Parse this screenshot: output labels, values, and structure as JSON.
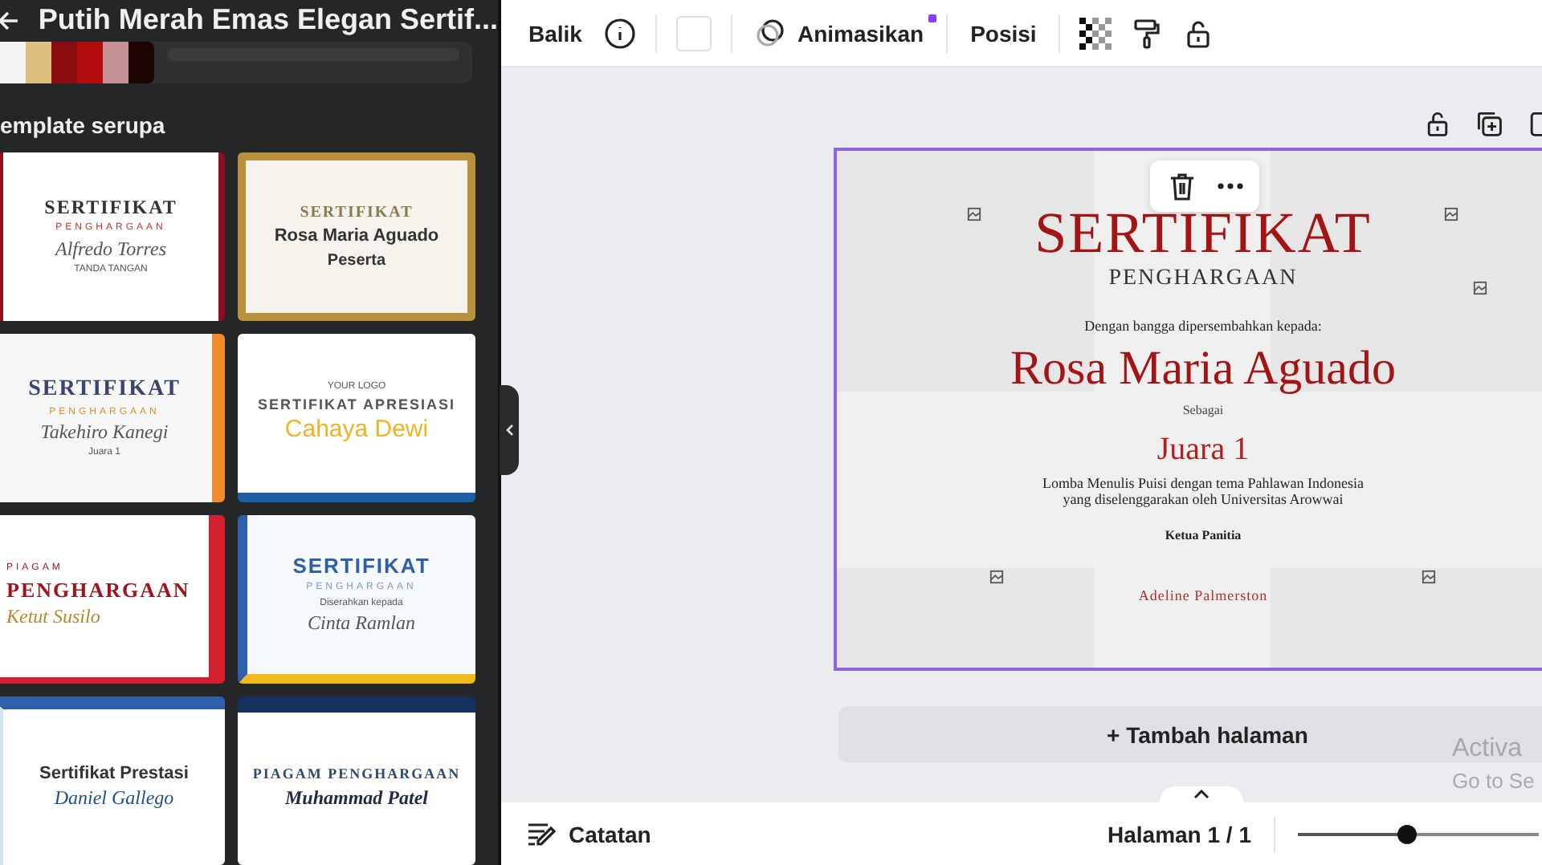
{
  "sidebar": {
    "title": "Putih Merah Emas Elegan Sertif...",
    "palette": [
      {
        "color": "#f4f4f4"
      },
      {
        "color": "#ddbf80"
      },
      {
        "color": "#8a0b0f"
      },
      {
        "color": "#b30a0b"
      },
      {
        "color": "#c39196"
      },
      {
        "color": "#1c0404"
      }
    ],
    "section_title": "emplate serupa",
    "templates": [
      {
        "kind": "red-ribbon",
        "texts": [
          {
            "kind": "title",
            "text": "SERTIFIKAT"
          },
          {
            "kind": "subtitle",
            "text": "PENGHARGAAN"
          },
          {
            "kind": "name",
            "text": "Alfredo Torres"
          },
          {
            "kind": "small",
            "text": "TANDA TANGAN"
          }
        ]
      },
      {
        "kind": "gold-frame",
        "texts": [
          {
            "kind": "title",
            "text": "SERTIFIKAT"
          },
          {
            "kind": "name",
            "text": "Rosa Maria Aguado"
          },
          {
            "kind": "extra",
            "text": "Peserta"
          }
        ]
      },
      {
        "kind": "orange-wave",
        "texts": [
          {
            "kind": "title",
            "text": "SERTIFIKAT"
          },
          {
            "kind": "subtitle",
            "text": "PENGHARGAAN"
          },
          {
            "kind": "name",
            "text": "Takehiro Kanegi"
          },
          {
            "kind": "small",
            "text": "Juara 1"
          }
        ]
      },
      {
        "kind": "apresiasi",
        "texts": [
          {
            "kind": "small",
            "text": "YOUR LOGO"
          },
          {
            "kind": "title",
            "text": "SERTIFIKAT APRESIASI"
          },
          {
            "kind": "name",
            "text": "Cahaya Dewi"
          }
        ]
      },
      {
        "kind": "red-arc",
        "texts": [
          {
            "kind": "subtitle",
            "text": "PIAGAM"
          },
          {
            "kind": "title",
            "text": "PENGHARGAAN"
          },
          {
            "kind": "name",
            "text": "Ketut Susilo"
          }
        ]
      },
      {
        "kind": "blue-geo",
        "texts": [
          {
            "kind": "title",
            "text": "SERTIFIKAT"
          },
          {
            "kind": "subtitle",
            "text": "PENGHARGAAN"
          },
          {
            "kind": "small",
            "text": "Diserahkan kepada"
          },
          {
            "kind": "name",
            "text": "Cinta Ramlan"
          }
        ]
      },
      {
        "kind": "prestasi",
        "texts": [
          {
            "kind": "title",
            "text": "Sertifikat Prestasi"
          },
          {
            "kind": "name",
            "text": "Daniel Gallego"
          }
        ]
      },
      {
        "kind": "navy-wave",
        "texts": [
          {
            "kind": "title",
            "text": "PIAGAM PENGHARGAAN"
          },
          {
            "kind": "name",
            "text": "Muhammad Patel"
          }
        ]
      }
    ]
  },
  "toolbar": {
    "flip": "Balik",
    "animate": "Animasikan",
    "animate_new": true,
    "position": "Posisi"
  },
  "page": {
    "texts": [
      {
        "kind": "title",
        "text": "SERTIFIKAT"
      },
      {
        "kind": "subtitle",
        "text": "PENGHARGAAN"
      },
      {
        "kind": "intro",
        "text": "Dengan bangga dipersembahkan kepada:"
      },
      {
        "kind": "name",
        "text": "Rosa Maria Aguado"
      },
      {
        "kind": "label",
        "text": "Sebagai"
      },
      {
        "kind": "rank",
        "text": "Juara 1"
      },
      {
        "kind": "description",
        "text": "Lomba Menulis Puisi dengan tema Pahlawan Indonesia"
      },
      {
        "kind": "description",
        "text": "yang diselenggarakan oleh Universitas Arowwai"
      },
      {
        "kind": "role",
        "text": "Ketua Panitia"
      },
      {
        "kind": "signer",
        "text": "Adeline Palmerston"
      }
    ]
  },
  "add_page": "+ Tambah halaman",
  "watermark": [
    "Activa",
    "Go to Se"
  ],
  "bottom_bar": {
    "notes": "Catatan",
    "page_indicator": "Halaman 1 / 1",
    "zoom": {
      "level": 0.45
    }
  }
}
